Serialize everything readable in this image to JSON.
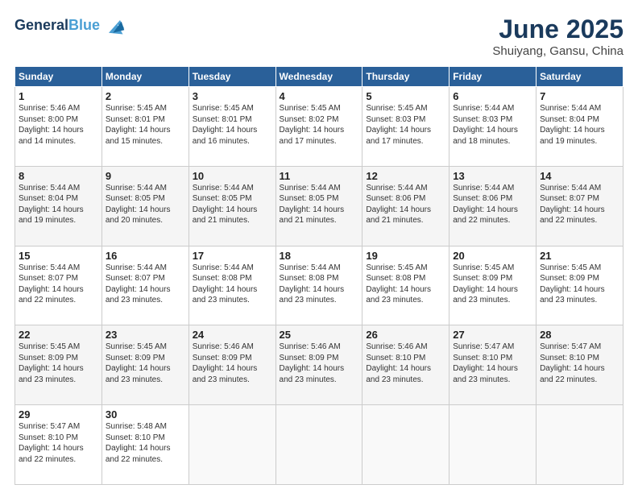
{
  "header": {
    "logo_line1": "General",
    "logo_line2": "Blue",
    "month": "June 2025",
    "location": "Shuiyang, Gansu, China"
  },
  "weekdays": [
    "Sunday",
    "Monday",
    "Tuesday",
    "Wednesday",
    "Thursday",
    "Friday",
    "Saturday"
  ],
  "weeks": [
    [
      {
        "day": "1",
        "sunrise": "5:46 AM",
        "sunset": "8:00 PM",
        "daylight": "14 hours and 14 minutes."
      },
      {
        "day": "2",
        "sunrise": "5:45 AM",
        "sunset": "8:01 PM",
        "daylight": "14 hours and 15 minutes."
      },
      {
        "day": "3",
        "sunrise": "5:45 AM",
        "sunset": "8:01 PM",
        "daylight": "14 hours and 16 minutes."
      },
      {
        "day": "4",
        "sunrise": "5:45 AM",
        "sunset": "8:02 PM",
        "daylight": "14 hours and 17 minutes."
      },
      {
        "day": "5",
        "sunrise": "5:45 AM",
        "sunset": "8:03 PM",
        "daylight": "14 hours and 17 minutes."
      },
      {
        "day": "6",
        "sunrise": "5:44 AM",
        "sunset": "8:03 PM",
        "daylight": "14 hours and 18 minutes."
      },
      {
        "day": "7",
        "sunrise": "5:44 AM",
        "sunset": "8:04 PM",
        "daylight": "14 hours and 19 minutes."
      }
    ],
    [
      {
        "day": "8",
        "sunrise": "5:44 AM",
        "sunset": "8:04 PM",
        "daylight": "14 hours and 19 minutes."
      },
      {
        "day": "9",
        "sunrise": "5:44 AM",
        "sunset": "8:05 PM",
        "daylight": "14 hours and 20 minutes."
      },
      {
        "day": "10",
        "sunrise": "5:44 AM",
        "sunset": "8:05 PM",
        "daylight": "14 hours and 21 minutes."
      },
      {
        "day": "11",
        "sunrise": "5:44 AM",
        "sunset": "8:05 PM",
        "daylight": "14 hours and 21 minutes."
      },
      {
        "day": "12",
        "sunrise": "5:44 AM",
        "sunset": "8:06 PM",
        "daylight": "14 hours and 21 minutes."
      },
      {
        "day": "13",
        "sunrise": "5:44 AM",
        "sunset": "8:06 PM",
        "daylight": "14 hours and 22 minutes."
      },
      {
        "day": "14",
        "sunrise": "5:44 AM",
        "sunset": "8:07 PM",
        "daylight": "14 hours and 22 minutes."
      }
    ],
    [
      {
        "day": "15",
        "sunrise": "5:44 AM",
        "sunset": "8:07 PM",
        "daylight": "14 hours and 22 minutes."
      },
      {
        "day": "16",
        "sunrise": "5:44 AM",
        "sunset": "8:07 PM",
        "daylight": "14 hours and 23 minutes."
      },
      {
        "day": "17",
        "sunrise": "5:44 AM",
        "sunset": "8:08 PM",
        "daylight": "14 hours and 23 minutes."
      },
      {
        "day": "18",
        "sunrise": "5:44 AM",
        "sunset": "8:08 PM",
        "daylight": "14 hours and 23 minutes."
      },
      {
        "day": "19",
        "sunrise": "5:45 AM",
        "sunset": "8:08 PM",
        "daylight": "14 hours and 23 minutes."
      },
      {
        "day": "20",
        "sunrise": "5:45 AM",
        "sunset": "8:09 PM",
        "daylight": "14 hours and 23 minutes."
      },
      {
        "day": "21",
        "sunrise": "5:45 AM",
        "sunset": "8:09 PM",
        "daylight": "14 hours and 23 minutes."
      }
    ],
    [
      {
        "day": "22",
        "sunrise": "5:45 AM",
        "sunset": "8:09 PM",
        "daylight": "14 hours and 23 minutes."
      },
      {
        "day": "23",
        "sunrise": "5:45 AM",
        "sunset": "8:09 PM",
        "daylight": "14 hours and 23 minutes."
      },
      {
        "day": "24",
        "sunrise": "5:46 AM",
        "sunset": "8:09 PM",
        "daylight": "14 hours and 23 minutes."
      },
      {
        "day": "25",
        "sunrise": "5:46 AM",
        "sunset": "8:09 PM",
        "daylight": "14 hours and 23 minutes."
      },
      {
        "day": "26",
        "sunrise": "5:46 AM",
        "sunset": "8:10 PM",
        "daylight": "14 hours and 23 minutes."
      },
      {
        "day": "27",
        "sunrise": "5:47 AM",
        "sunset": "8:10 PM",
        "daylight": "14 hours and 23 minutes."
      },
      {
        "day": "28",
        "sunrise": "5:47 AM",
        "sunset": "8:10 PM",
        "daylight": "14 hours and 22 minutes."
      }
    ],
    [
      {
        "day": "29",
        "sunrise": "5:47 AM",
        "sunset": "8:10 PM",
        "daylight": "14 hours and 22 minutes."
      },
      {
        "day": "30",
        "sunrise": "5:48 AM",
        "sunset": "8:10 PM",
        "daylight": "14 hours and 22 minutes."
      },
      null,
      null,
      null,
      null,
      null
    ]
  ]
}
